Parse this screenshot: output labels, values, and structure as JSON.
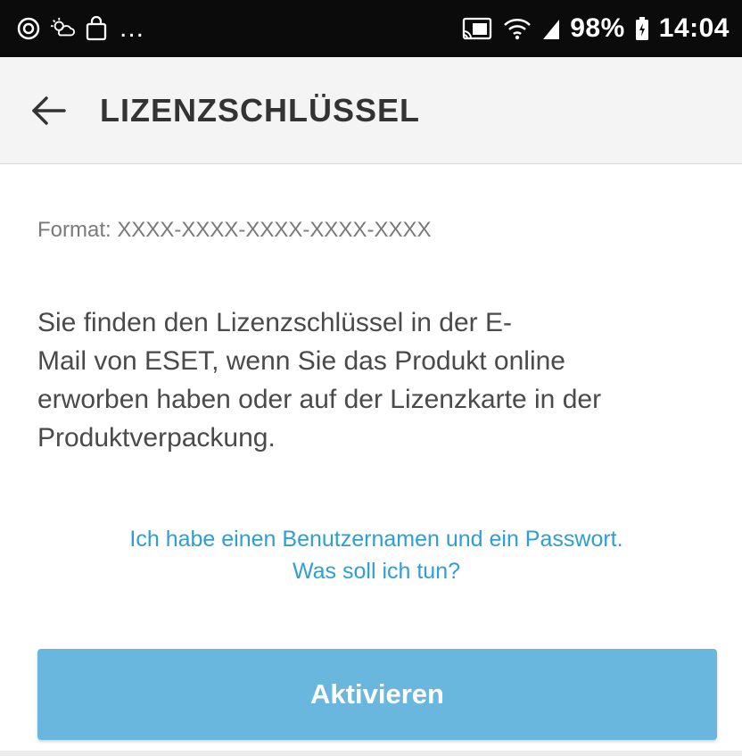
{
  "status_bar": {
    "left_icons": [
      "sync-circle-icon",
      "weather-icon",
      "shopping-bag-icon"
    ],
    "overflow_text": "...",
    "right_icons": [
      "cast-icon",
      "wifi-icon",
      "signal-icon",
      "battery-icon"
    ],
    "battery_text": "98%",
    "time": "14:04"
  },
  "app_bar": {
    "back_icon": "arrow-left-icon",
    "title": "LIZENZSCHLÜSSEL"
  },
  "main": {
    "format_hint": "Format: XXXX-XXXX-XXXX-XXXX-XXXX",
    "description_lines": [
      "Sie finden den Lizenzschlüssel in der E-",
      "Mail von ESET, wenn Sie das Produkt online",
      "erworben haben oder auf der Lizenzkarte in der",
      "Produktverpackung."
    ],
    "help_link_lines": [
      "Ich habe einen Benutzernamen und ein Passwort.",
      "Was soll ich tun?"
    ],
    "activate_label": "Aktivieren"
  },
  "colors": {
    "status_bar_bg": "#0b0b0b",
    "app_bar_bg": "#f4f4f4",
    "link": "#2e9fd1",
    "button_bg": "#69b7df"
  }
}
